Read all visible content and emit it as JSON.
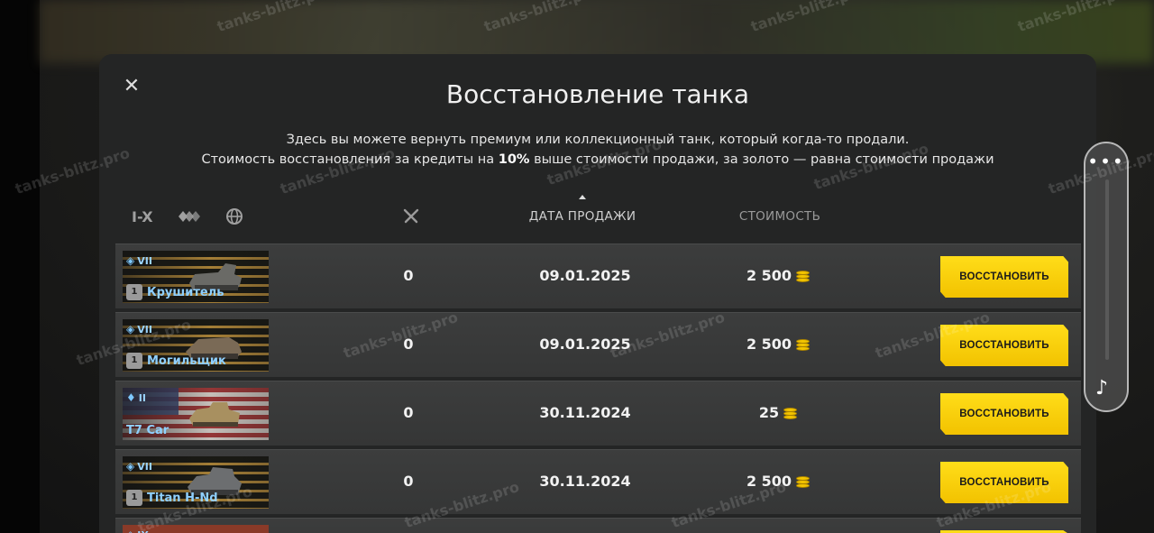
{
  "dialog": {
    "title": "Восстановление танка",
    "desc_line1": "Здесь вы можете вернуть премиум или коллекционный танк, который когда-то продали.",
    "desc_line2_pre": "Стоимость восстановления за кредиты на ",
    "desc_line2_pct": "10%",
    "desc_line2_post": " выше стоимости продажи, за золото — равна стоимости продажи"
  },
  "filters": {
    "tiers": "I-X"
  },
  "columns": {
    "date": "ДАТА ПРОДАЖИ",
    "cost": "СТОИМОСТЬ"
  },
  "rows": [
    {
      "tier": "VII",
      "name": "Крушитель",
      "mastery": "1",
      "battles": "0",
      "date": "09.01.2025",
      "cost": "2 500",
      "button": "ВОССТАНОВИТЬ"
    },
    {
      "tier": "VII",
      "name": "Могильщик",
      "mastery": "1",
      "battles": "0",
      "date": "09.01.2025",
      "cost": "2 500",
      "button": "ВОССТАНОВИТЬ"
    },
    {
      "tier": "II",
      "name": "T7 Car",
      "mastery": "",
      "battles": "0",
      "date": "30.11.2024",
      "cost": "25",
      "button": "ВОССТАНОВИТЬ"
    },
    {
      "tier": "VII",
      "name": "Titan H-Nd",
      "mastery": "1",
      "battles": "0",
      "date": "30.11.2024",
      "cost": "2 500",
      "button": "ВОССТАНОВИТЬ"
    },
    {
      "tier": "IX",
      "name": "",
      "mastery": "",
      "battles": "",
      "date": "",
      "cost": "",
      "button": ""
    }
  ],
  "side": {
    "dots": "•••",
    "note": "♪"
  },
  "watermark": "tanks-blitz.pro",
  "icons": {
    "close": "close-icon",
    "class": "diamond-icon",
    "nation": "globe-icon",
    "battles": "crossed-swords-icon",
    "coin": "gold-coin-icon"
  },
  "colors": {
    "accent": "#f2c200",
    "tank_name": "#8fd0ff"
  }
}
